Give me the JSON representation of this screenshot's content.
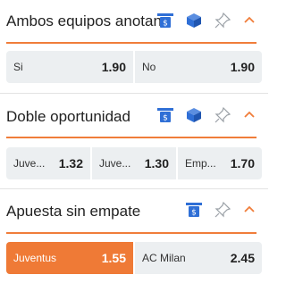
{
  "markets": [
    {
      "title": "Ambos equipos anotan",
      "icons": [
        "bet-builder-icon",
        "stats-cube-icon",
        "pin-icon",
        "chevron-up-icon"
      ],
      "selections": [
        {
          "label": "Si",
          "odd": "1.90"
        },
        {
          "label": "No",
          "odd": "1.90"
        }
      ]
    },
    {
      "title": "Doble oportunidad",
      "icons": [
        "bet-builder-icon",
        "stats-cube-icon",
        "pin-icon",
        "chevron-up-icon"
      ],
      "selections": [
        {
          "label": "Juve...",
          "odd": "1.32"
        },
        {
          "label": "Juve...",
          "odd": "1.30"
        },
        {
          "label": "Emp...",
          "odd": "1.70"
        }
      ]
    },
    {
      "title": "Apuesta sin empate",
      "icons": [
        "bet-builder-icon",
        "pin-icon",
        "chevron-up-icon"
      ],
      "selections": [
        {
          "label": "Juventus",
          "odd": "1.55",
          "selected": true
        },
        {
          "label": "AC Milan",
          "odd": "2.45"
        }
      ]
    }
  ],
  "colors": {
    "accent": "#f07d3a",
    "selected": "#ef7a36",
    "icon_blue": "#2f6fd6"
  }
}
